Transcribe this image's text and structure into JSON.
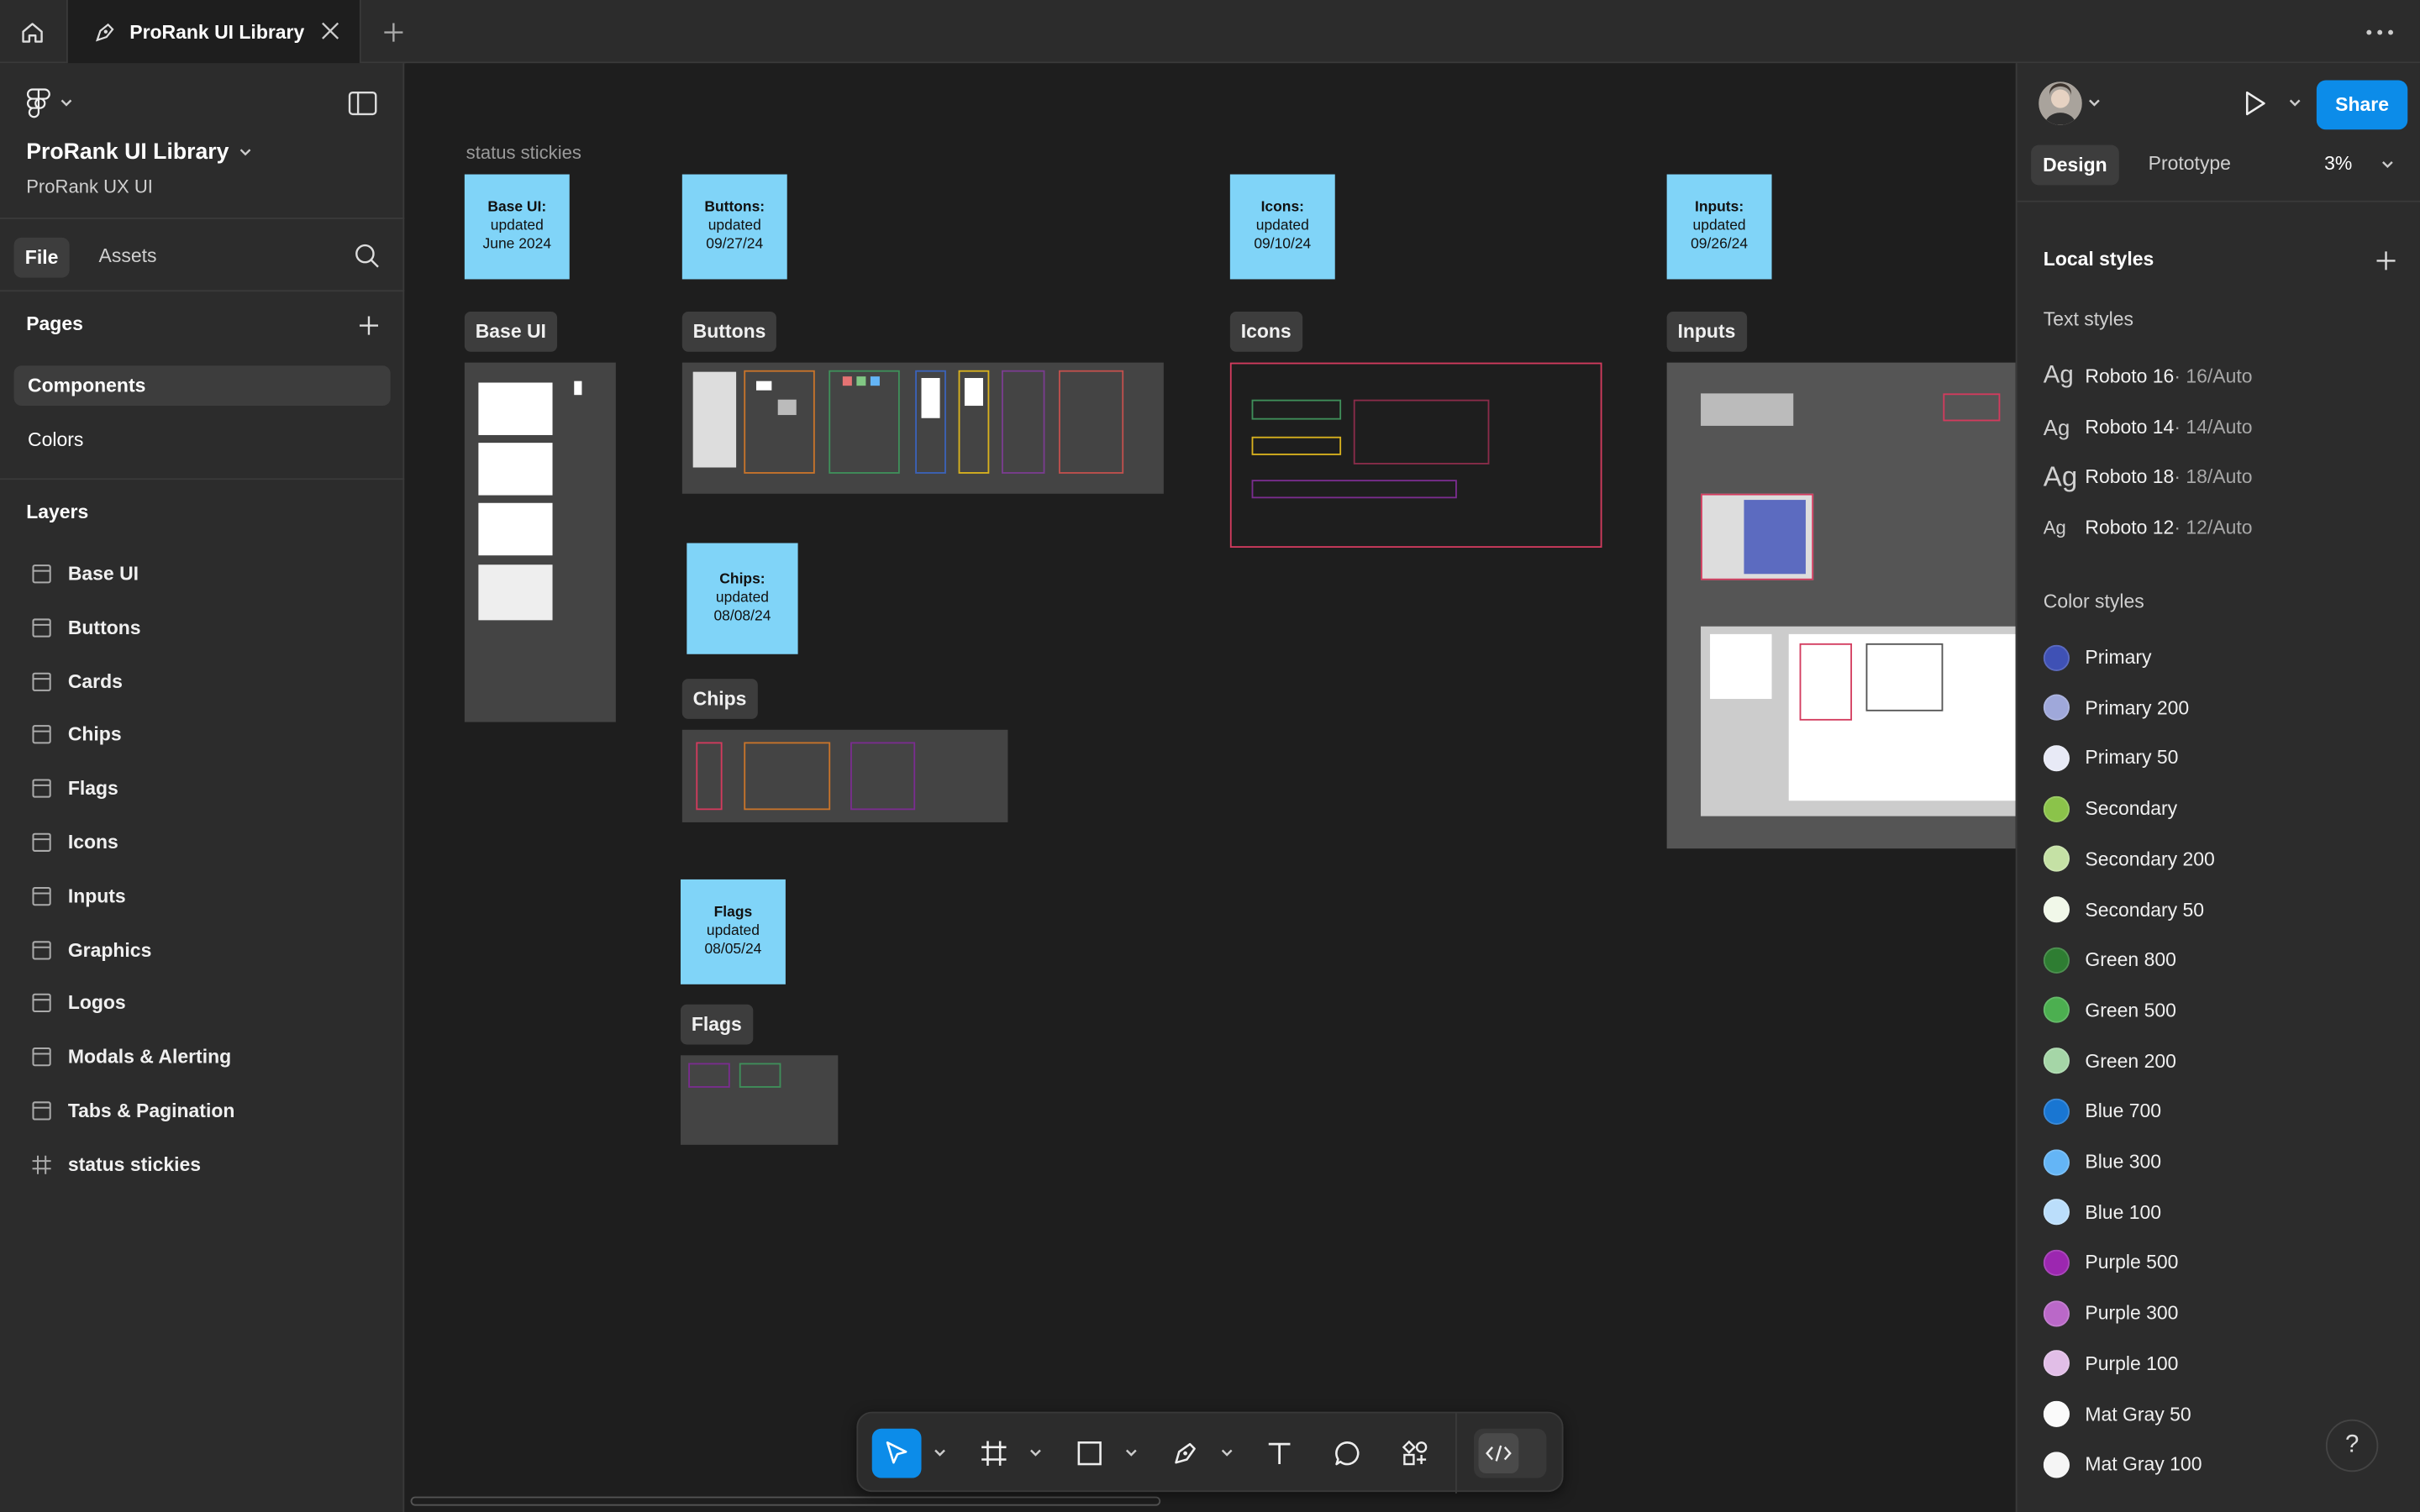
{
  "tab": {
    "title": "ProRank UI Library"
  },
  "file": {
    "name": "ProRank UI Library",
    "project": "ProRank UX UI"
  },
  "left_tabs": {
    "file": "File",
    "assets": "Assets"
  },
  "pages": {
    "heading": "Pages",
    "items": [
      {
        "label": "Components",
        "selected": true
      },
      {
        "label": "Colors",
        "selected": false
      }
    ]
  },
  "layers": {
    "heading": "Layers",
    "items": [
      {
        "label": "Base UI",
        "icon": "frame-section-icon"
      },
      {
        "label": "Buttons",
        "icon": "frame-section-icon"
      },
      {
        "label": "Cards",
        "icon": "frame-section-icon"
      },
      {
        "label": "Chips",
        "icon": "frame-section-icon"
      },
      {
        "label": "Flags",
        "icon": "frame-section-icon"
      },
      {
        "label": "Icons",
        "icon": "frame-section-icon"
      },
      {
        "label": "Inputs",
        "icon": "frame-section-icon"
      },
      {
        "label": "Graphics",
        "icon": "frame-section-icon"
      },
      {
        "label": "Logos",
        "icon": "frame-section-icon"
      },
      {
        "label": "Modals & Alerting",
        "icon": "frame-section-icon"
      },
      {
        "label": "Tabs & Pagination",
        "icon": "frame-section-icon"
      },
      {
        "label": "status stickies",
        "icon": "hash-frame-icon"
      }
    ]
  },
  "canvas": {
    "section_label": "status stickies",
    "stickies": {
      "base": {
        "title": "Base UI:",
        "line2": "updated",
        "line3": "June 2024"
      },
      "buttons": {
        "title": "Buttons:",
        "line2": "updated",
        "line3": "09/27/24"
      },
      "icons": {
        "title": "Icons:",
        "line2": "updated",
        "line3": "09/10/24"
      },
      "inputs": {
        "title": "Inputs:",
        "line2": "updated",
        "line3": "09/26/24"
      },
      "chips": {
        "title": "Chips:",
        "line2": "updated",
        "line3": "08/08/24"
      },
      "flags": {
        "title": "Flags",
        "line2": "updated",
        "line3": "08/05/24"
      }
    },
    "frames": {
      "base": "Base UI",
      "buttons": "Buttons",
      "icons": "Icons",
      "inputs": "Inputs",
      "chips": "Chips",
      "flags": "Flags"
    },
    "sticky_color": "#80d4f8"
  },
  "right": {
    "share": "Share",
    "tabs": {
      "design": "Design",
      "prototype": "Prototype"
    },
    "zoom": "3%",
    "local_styles": "Local styles",
    "text_styles_heading": "Text styles",
    "text_styles": [
      {
        "ag": "Ag",
        "name": "Roboto 16",
        "spec": " · 16/Auto"
      },
      {
        "ag": "Ag",
        "name": "Roboto 14",
        "spec": " · 14/Auto"
      },
      {
        "ag": "Ag",
        "name": "Roboto 18",
        "spec": " · 18/Auto"
      },
      {
        "ag": "Ag",
        "name": "Roboto 12",
        "spec": " · 12/Auto"
      }
    ],
    "color_styles_heading": "Color styles",
    "color_styles": [
      {
        "name": "Primary",
        "color": "#3f51b5"
      },
      {
        "name": "Primary 200",
        "color": "#9fa8da"
      },
      {
        "name": "Primary 50",
        "color": "#e8eaf6"
      },
      {
        "name": "Secondary",
        "color": "#8bc34a"
      },
      {
        "name": "Secondary 200",
        "color": "#c5e1a5"
      },
      {
        "name": "Secondary 50",
        "color": "#f1f8e9"
      },
      {
        "name": "Green 800",
        "color": "#2e7d32"
      },
      {
        "name": "Green 500",
        "color": "#4caf50"
      },
      {
        "name": "Green 200",
        "color": "#a5d6a7"
      },
      {
        "name": "Blue 700",
        "color": "#1976d2"
      },
      {
        "name": "Blue 300",
        "color": "#64b5f6"
      },
      {
        "name": "Blue 100",
        "color": "#bbdefb"
      },
      {
        "name": "Purple 500",
        "color": "#9c27b0"
      },
      {
        "name": "Purple 300",
        "color": "#ba68c8"
      },
      {
        "name": "Purple 100",
        "color": "#e1bee7"
      },
      {
        "name": "Mat Gray 50",
        "color": "#fafafa"
      },
      {
        "name": "Mat Gray 100",
        "color": "#f5f5f5"
      }
    ]
  },
  "help": "?"
}
